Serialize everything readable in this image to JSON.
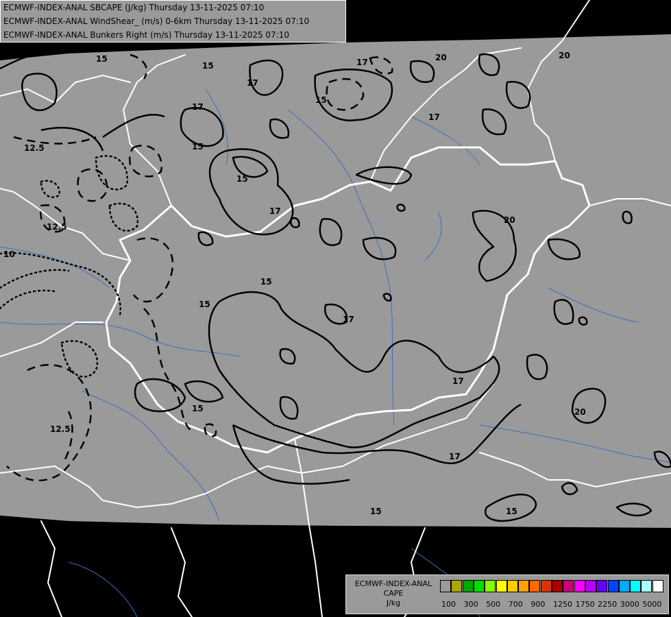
{
  "header": {
    "lines": [
      "ECMWF-INDEX-ANAL SBCAPE (J/kg) Thursday 13-11-2025 07:10",
      "ECMWF-INDEX-ANAL WindShear_ (m/s) 0-6km Thursday 13-11-2025 07:10",
      "ECMWF-INDEX-ANAL Bunkers Right (m/s) Thursday 13-11-2025 07:10"
    ]
  },
  "map": {
    "background_color": "#9a9a9a",
    "outside_color": "#000000",
    "contour_labels": [
      "15",
      "17",
      "20",
      "12.5",
      "10"
    ]
  },
  "legend": {
    "line1": "ECMWF-INDEX-ANAL",
    "line2": "CAPE",
    "line3": "J/kg",
    "colors": [
      "#9a9a9a",
      "#a8a800",
      "#00a800",
      "#00dd00",
      "#88ff00",
      "#ffff00",
      "#ffcc00",
      "#ffa200",
      "#ff6600",
      "#dd3300",
      "#aa0000",
      "#cc0077",
      "#ff00ff",
      "#bb00ff",
      "#6600ff",
      "#0044ff",
      "#00aaff",
      "#00ffff",
      "#aaffff",
      "#ffffff"
    ],
    "ticks": [
      "100",
      "300",
      "500",
      "700",
      "900",
      "1250",
      "1750",
      "2250",
      "3000",
      "5000"
    ]
  }
}
